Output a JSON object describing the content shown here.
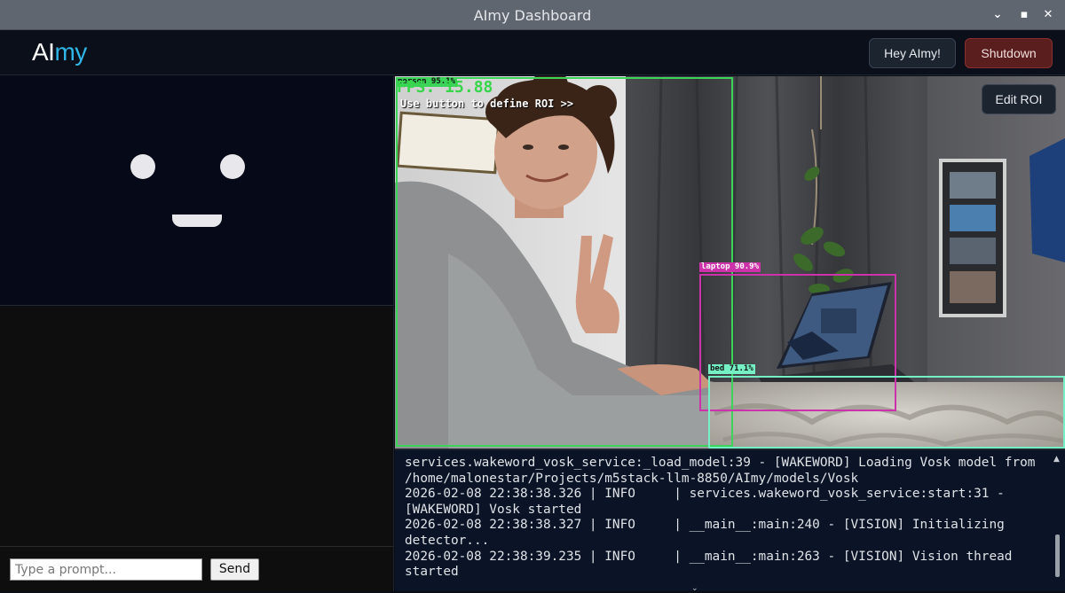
{
  "window": {
    "title": "AImy Dashboard",
    "controls": {
      "minimize": "⌄",
      "maximize": "▪",
      "close": "✕"
    }
  },
  "header": {
    "logo_prefix": "AI",
    "logo_suffix": "my",
    "hey_button": "Hey AImy!",
    "shutdown_button": "Shutdown",
    "colors": {
      "logo_accent": "#2fb6e6",
      "shutdown_bg": "#5a1e1e"
    }
  },
  "face": {
    "expression": "smile",
    "color": "#e8e8ec"
  },
  "prompt": {
    "placeholder": "Type a prompt...",
    "value": "",
    "send_button": "Send"
  },
  "camera": {
    "edit_roi_button": "Edit ROI",
    "fps_text": "FPS: 15.88",
    "hint": "Use button to define ROI >>",
    "detections": [
      {
        "label": "person 95.1%",
        "color": "#3cd35a"
      },
      {
        "label": "laptop 90.9%",
        "color": "#cc33aa"
      },
      {
        "label": "bed 71.1%",
        "color": "#74f0c4"
      }
    ]
  },
  "log": {
    "lines": [
      "services.wakeword_vosk_service:_load_model:39 - [WAKEWORD] Loading Vosk model from /home/malonestar/Projects/m5stack-llm-8850/AImy/models/Vosk",
      "2026-02-08 22:38:38.326 | INFO     | services.wakeword_vosk_service:start:31 - [WAKEWORD] Vosk started",
      "2026-02-08 22:38:38.327 | INFO     | __main__:main:240 - [VISION] Initializing detector...",
      "2026-02-08 22:38:39.235 | INFO     | __main__:main:263 - [VISION] Vision thread started"
    ]
  }
}
